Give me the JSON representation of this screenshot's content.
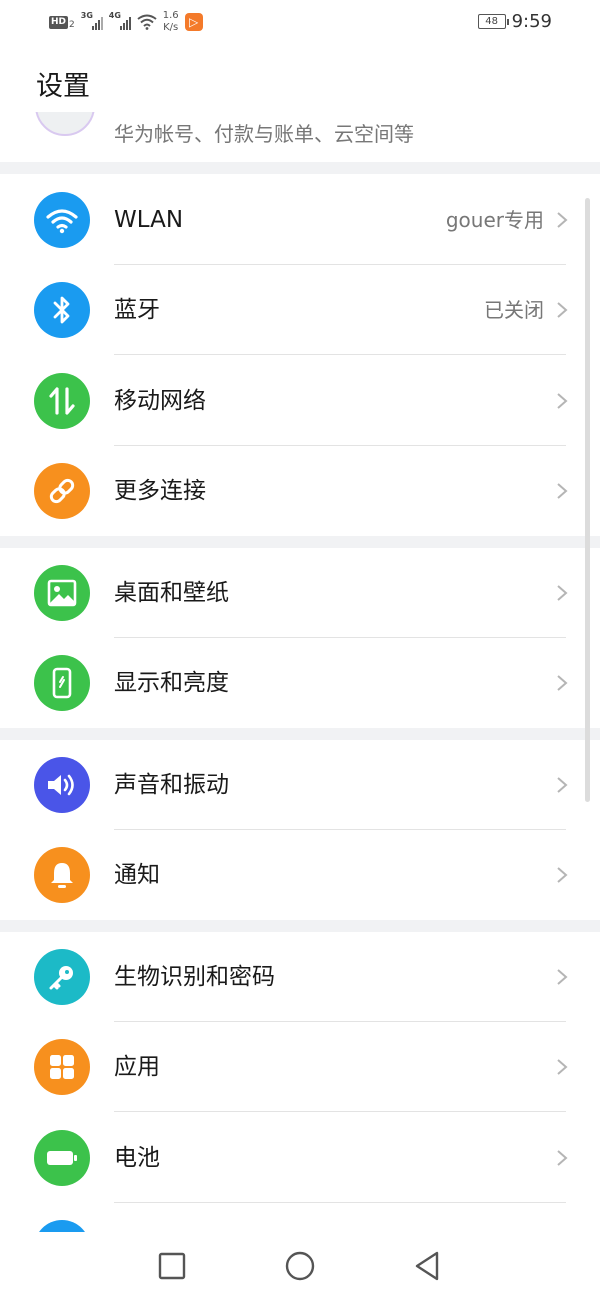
{
  "status_bar": {
    "hd": "HD",
    "hd_sub": "2",
    "net1": "3G",
    "net2": "4G",
    "speed_value": "1.6",
    "speed_unit": "K/s",
    "battery": "48",
    "time": "9:59"
  },
  "header": {
    "title": "设置",
    "account_subtitle": "华为帐号、付款与账单、云空间等"
  },
  "sections": [
    [
      {
        "label": "WLAN",
        "value": "gouer专用",
        "icon": "wifi-icon",
        "color": "#1a9bf0"
      },
      {
        "label": "蓝牙",
        "value": "已关闭",
        "icon": "bluetooth-icon",
        "color": "#1a9bf0"
      },
      {
        "label": "移动网络",
        "value": "",
        "icon": "mobile-data-icon",
        "color": "#3cc24b"
      },
      {
        "label": "更多连接",
        "value": "",
        "icon": "link-icon",
        "color": "#f7901e"
      }
    ],
    [
      {
        "label": "桌面和壁纸",
        "value": "",
        "icon": "image-icon",
        "color": "#3cc24b"
      },
      {
        "label": "显示和亮度",
        "value": "",
        "icon": "display-icon",
        "color": "#3cc24b"
      }
    ],
    [
      {
        "label": "声音和振动",
        "value": "",
        "icon": "volume-icon",
        "color": "#4a55e8"
      },
      {
        "label": "通知",
        "value": "",
        "icon": "bell-icon",
        "color": "#f7901e"
      }
    ],
    [
      {
        "label": "生物识别和密码",
        "value": "",
        "icon": "key-icon",
        "color": "#1cbac7"
      },
      {
        "label": "应用",
        "value": "",
        "icon": "apps-icon",
        "color": "#f7901e"
      },
      {
        "label": "电池",
        "value": "",
        "icon": "battery-icon",
        "color": "#3cc24b"
      }
    ]
  ],
  "nav": {
    "recent": "square-icon",
    "home": "circle-icon",
    "back": "triangle-back-icon"
  }
}
